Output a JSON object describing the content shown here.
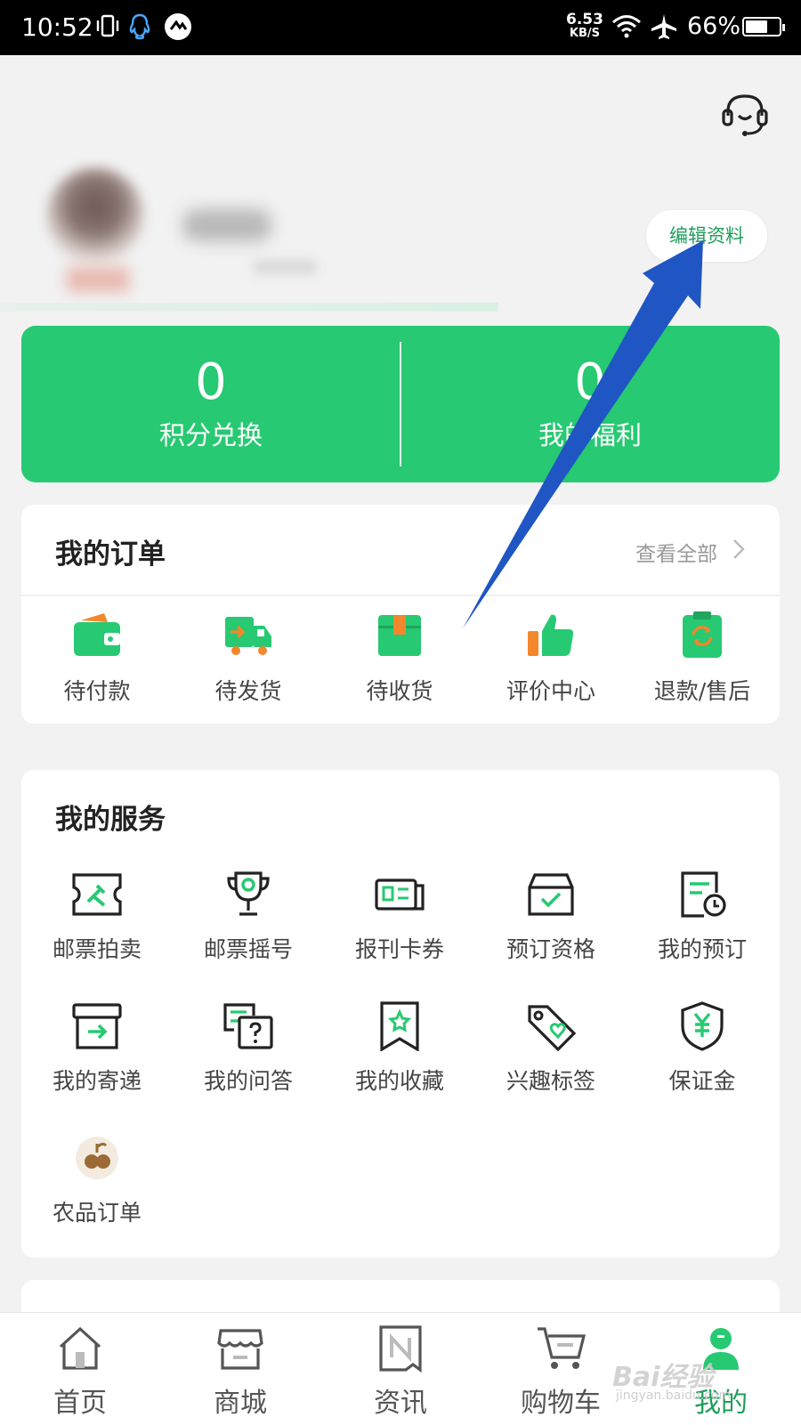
{
  "status_bar": {
    "time": "10:52",
    "net_speed_value": "6.53",
    "net_speed_unit": "KB/S",
    "battery_text": "66%",
    "battery_level": 0.66
  },
  "profile": {
    "edit_label": "编辑资料"
  },
  "stats": [
    {
      "value": "0",
      "label": "积分兑换"
    },
    {
      "value": "0",
      "label": "我的福利"
    }
  ],
  "orders": {
    "title": "我的订单",
    "view_all": "查看全部",
    "items": [
      {
        "label": "待付款",
        "icon": "wallet-icon"
      },
      {
        "label": "待发货",
        "icon": "delivery-truck-icon"
      },
      {
        "label": "待收货",
        "icon": "package-box-icon"
      },
      {
        "label": "评价中心",
        "icon": "thumbs-up-icon"
      },
      {
        "label": "退款/售后",
        "icon": "refund-clipboard-icon"
      }
    ]
  },
  "services": {
    "title": "我的服务",
    "items": [
      {
        "label": "邮票拍卖",
        "icon": "stamp-auction-icon"
      },
      {
        "label": "邮票摇号",
        "icon": "trophy-icon"
      },
      {
        "label": "报刊卡券",
        "icon": "card-coupon-icon"
      },
      {
        "label": "预订资格",
        "icon": "checked-box-icon"
      },
      {
        "label": "我的预订",
        "icon": "clock-document-icon"
      },
      {
        "label": "我的寄递",
        "icon": "mail-out-box-icon"
      },
      {
        "label": "我的问答",
        "icon": "question-chat-icon"
      },
      {
        "label": "我的收藏",
        "icon": "bookmark-star-icon"
      },
      {
        "label": "兴趣标签",
        "icon": "heart-tag-icon"
      },
      {
        "label": "保证金",
        "icon": "yuan-shield-icon"
      },
      {
        "label": "农品订单",
        "icon": "fruit-icon"
      }
    ]
  },
  "bottom_nav": [
    {
      "label": "首页",
      "icon": "home-icon"
    },
    {
      "label": "商城",
      "icon": "store-icon"
    },
    {
      "label": "资讯",
      "icon": "news-icon"
    },
    {
      "label": "购物车",
      "icon": "cart-icon"
    },
    {
      "label": "我的",
      "icon": "profile-icon",
      "active": true
    }
  ],
  "watermark": {
    "brand": "Bai经验",
    "url": "jingyan.baidu.com"
  },
  "colors": {
    "primary_green": "#27c972",
    "accent_green": "#1e9d5a",
    "annotation_arrow": "#1f56c4",
    "orange": "#f2872c"
  }
}
